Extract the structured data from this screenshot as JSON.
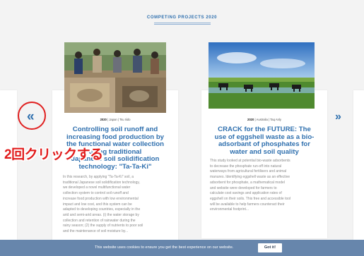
{
  "section_title": "COMPETING PROJECTS 2020",
  "nav": {
    "prev_symbol": "«",
    "next_symbol": "»"
  },
  "annotation": {
    "text": "2回クリックする",
    "color": "#e11b1b"
  },
  "colors": {
    "accent": "#2e6fae",
    "annotation_red": "#e02020",
    "cookie_bar": "#5f7fa8"
  },
  "projects": [
    {
      "year": "2020",
      "meta": "| Japan | Tsu Iiido",
      "title_lines": [
        "Controlling soil runoff and",
        "increasing food production by",
        "the functional water collection",
        "using traditional",
        "Japanese soil solidification",
        "technology: \"Ta-Ta-Ki\""
      ],
      "desc_lines": [
        "In this research, by applying \"Ta-Ta-Ki\" soil, a",
        "traditional Japanese soil solidification technology,",
        "we developed a novel multifunctional water",
        "collection system to control soil runoff and",
        "increase food production with low environmental",
        "impact and low cost, and this system can be",
        "adapted to developing countries, especially in the",
        "arid and semi-arid areas. (i) the water storage by",
        "collection and retention of rainwater during the",
        "rainy season; (2) the supply of nutrients to poor soil",
        "and the maintenance of soil moisture by..."
      ]
    },
    {
      "year": "2020",
      "meta": "| Australia | Taq Anly",
      "title_lines": [
        "CRACK for the FUTURE: The",
        "use of eggshell waste as a bio-",
        "adsorbant of phosphates for",
        "water and soil quality"
      ],
      "desc_lines": [
        "This study looked at potential bio-waste adsorbents",
        "to decrease the phosphate run-off into natural",
        "waterways from agricultural fertilisers and animal",
        "manures. Identifying eggshell waste as an effective",
        "adsorbent for phosphate, a mathematical model",
        "and website were developed for farmers to",
        "calculate cost savings and application rates of",
        "eggshell on their soils. This free and accessible tool",
        "will be available to help farmers counteract their",
        "environmental footprint..."
      ]
    }
  ],
  "cookie": {
    "text": "This website uses cookies to ensure you get the best experience on our website.",
    "button": "Got it!"
  }
}
